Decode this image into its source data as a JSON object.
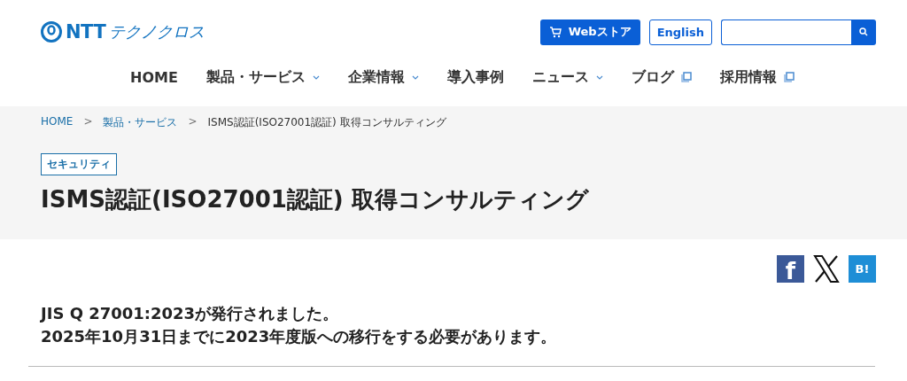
{
  "logo": {
    "mark": "NTT",
    "name": "テクノクロス"
  },
  "header_buttons": {
    "store": "Webストア",
    "language": "English"
  },
  "nav": [
    {
      "label": "HOME",
      "kind": "plain"
    },
    {
      "label": "製品・サービス",
      "kind": "dropdown"
    },
    {
      "label": "企業情報",
      "kind": "dropdown"
    },
    {
      "label": "導入事例",
      "kind": "plain"
    },
    {
      "label": "ニュース",
      "kind": "dropdown"
    },
    {
      "label": "ブログ",
      "kind": "external"
    },
    {
      "label": "採用情報",
      "kind": "external"
    }
  ],
  "breadcrumbs": [
    {
      "label": "HOME",
      "kind": "link"
    },
    {
      "label": ">",
      "kind": "separator"
    },
    {
      "label": "製品・サービス",
      "kind": "link"
    },
    {
      "label": ">",
      "kind": "separator"
    },
    {
      "label": "ISMS認証(ISO27001認証) 取得コンサルティング",
      "kind": "current"
    }
  ],
  "category_tag": "セキュリティ",
  "page_title": "ISMS認証(ISO27001認証) 取得コンサルティング",
  "share": [
    {
      "kind": "facebook",
      "label": "f"
    },
    {
      "kind": "x"
    },
    {
      "kind": "hatena",
      "label": "B!"
    }
  ],
  "notice": [
    "JIS Q 27001:2023が発行されました。",
    "2025年10月31日までに2023年度版への移行をする必要があります。"
  ]
}
